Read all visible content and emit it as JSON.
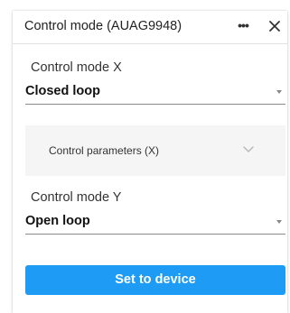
{
  "dialog": {
    "title": "Control mode (AUAG9948)",
    "menu_glyph": "•••",
    "close_icon": "close-icon"
  },
  "control_x": {
    "label": "Control mode X",
    "value": "Closed loop"
  },
  "parameters_x": {
    "label": "Control parameters (X)",
    "expanded": false
  },
  "control_y": {
    "label": "Control mode Y",
    "value": "Open loop"
  },
  "actions": {
    "set_label": "Set to device"
  },
  "colors": {
    "accent": "#1e9bf5",
    "expander_bg": "#f5f5f5",
    "text": "#222222"
  }
}
